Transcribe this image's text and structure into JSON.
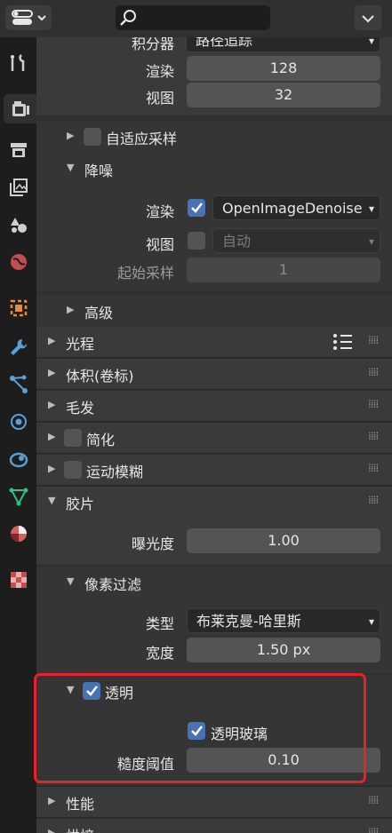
{
  "top": {
    "label_sampler_partial": "积分器",
    "value_sampler_partial": "路径追踪"
  },
  "samples": {
    "render_label": "渲染",
    "render_value": "128",
    "viewport_label": "视图",
    "viewport_value": "32"
  },
  "adaptive": {
    "label": "自适应采样"
  },
  "denoise": {
    "label": "降噪",
    "render_label": "渲染",
    "render_value": "OpenImageDenoise",
    "viewport_label": "视图",
    "viewport_value": "自动",
    "start_label": "起始采样",
    "start_value": "1"
  },
  "advanced": {
    "label": "高级"
  },
  "panels": {
    "light_paths": "光程",
    "volumes": "体积(卷标)",
    "hair": "毛发",
    "simplify": "简化",
    "motion_blur": "运动模糊",
    "film": "胶片"
  },
  "film": {
    "exposure_label": "曝光度",
    "exposure_value": "1.00",
    "pixel_filter_label": "像素过滤",
    "type_label": "类型",
    "type_value": "布莱克曼-哈里斯",
    "width_label": "宽度",
    "width_value": "1.50 px",
    "transparent_label": "透明",
    "transparent_glass_label": "透明玻璃",
    "roughness_label": "糙度阈值",
    "roughness_value": "0.10"
  },
  "bottom_panels": {
    "performance": "性能",
    "bake_partial": "烘焙"
  },
  "colors": {
    "accent": "#4772b3",
    "highlight": "#e8222a",
    "panel": "#3a3a3a",
    "bg": "#303030"
  }
}
